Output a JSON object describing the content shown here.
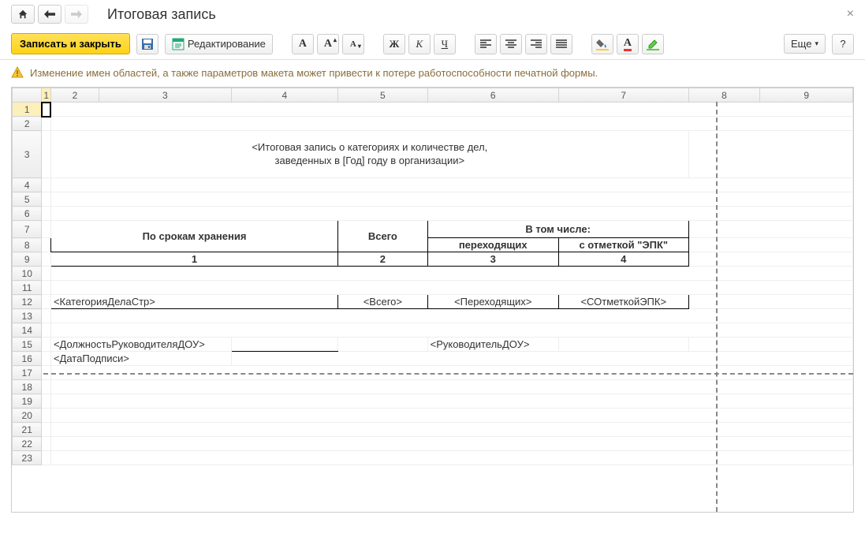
{
  "header": {
    "title": "Итоговая запись"
  },
  "toolbar": {
    "writeAndClose": "Записать и закрыть",
    "editing": "Редактирование",
    "more": "Еще",
    "help": "?"
  },
  "warning": "Изменение имен областей, а также параметров макета может привести к потере работоспособности печатной формы.",
  "columnsHeaders": [
    "1",
    "2",
    "3",
    "4",
    "5",
    "6",
    "7",
    "8",
    "9"
  ],
  "rowsHeaders": [
    "1",
    "2",
    "3",
    "4",
    "5",
    "6",
    "7",
    "8",
    "9",
    "10",
    "11",
    "12",
    "13",
    "14",
    "15",
    "16",
    "17",
    "18",
    "19",
    "20",
    "21",
    "22",
    "23"
  ],
  "doc": {
    "bigTitle1": "<Итоговая запись о категориях и количестве дел,",
    "bigTitle2": "заведенных в [Год] году в организации>",
    "h1": "По срокам хранения",
    "h2": "Всего",
    "h3": "В том числе:",
    "h3a": "переходящих",
    "h3b": "с отметкой \"ЭПК\"",
    "n1": "1",
    "n2": "2",
    "n3": "3",
    "n4": "4",
    "cat": "<КатегорияДелаСтр>",
    "total": "<Всего>",
    "trans": "<Переходящих>",
    "mark": "<СОтметкойЭПК>",
    "pos": "<ДолжностьРуководителяДОУ>",
    "mgr": "<РуководительДОУ>",
    "date": "<ДатаПодписи>"
  }
}
